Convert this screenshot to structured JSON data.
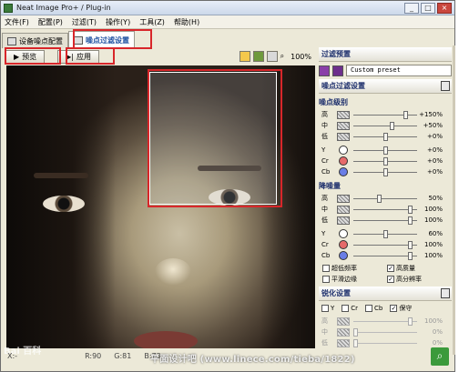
{
  "window": {
    "title": "Neat Image Pro+ / Plug-in",
    "buttons": [
      "_",
      "□",
      "×"
    ]
  },
  "menu": [
    "文件(F)",
    "配置(P)",
    "过滤(T)",
    "操作(Y)",
    "工具(Z)",
    "帮助(H)"
  ],
  "tabs": [
    {
      "label": "设备噪点配置",
      "active": false
    },
    {
      "label": "噪点过滤设置",
      "active": true
    }
  ],
  "toolbar": {
    "preview_label": "预览",
    "apply_label": "应用",
    "zoom": "100%"
  },
  "status": {
    "xy": "X:-",
    "r": "R:90",
    "g": "G:81",
    "b": "B:73"
  },
  "watermark": {
    "left": "Bai 百科",
    "bottom": "平面设计吧 (www.linece.com/tieba/1822)"
  },
  "filter_preset": {
    "title": "过滤预置",
    "value": "Custom preset"
  },
  "noise_filter": {
    "title": "噪点过滤设置",
    "level_title": "噪点级别",
    "levels": [
      {
        "label": "高",
        "value": "+150%",
        "pos": 0.85
      },
      {
        "label": "中",
        "value": "+50%",
        "pos": 0.62
      },
      {
        "label": "低",
        "value": "+0%",
        "pos": 0.5
      }
    ],
    "channels": [
      {
        "label": "Y",
        "value": "+0%",
        "color": "#ffffff",
        "pos": 0.5
      },
      {
        "label": "Cr",
        "value": "+0%",
        "color": "#e66a6a",
        "pos": 0.5
      },
      {
        "label": "Cb",
        "value": "+0%",
        "color": "#6a7ee6",
        "pos": 0.5
      }
    ],
    "reduction_title": "降噪量",
    "reductions": [
      {
        "label": "高",
        "value": "50%",
        "pos": 0.4
      },
      {
        "label": "中",
        "value": "100%",
        "pos": 0.92
      },
      {
        "label": "低",
        "value": "100%",
        "pos": 0.92
      }
    ],
    "reduction_channels": [
      {
        "label": "Y",
        "value": "60%",
        "color": "#ffffff",
        "pos": 0.5
      },
      {
        "label": "Cr",
        "value": "100%",
        "color": "#e66a6a",
        "pos": 0.92
      },
      {
        "label": "Cb",
        "value": "100%",
        "color": "#6a7ee6",
        "pos": 0.92
      }
    ],
    "options": [
      {
        "label": "超低频率",
        "checked": false
      },
      {
        "label": "高质量",
        "checked": true
      },
      {
        "label": "平滑边缘",
        "checked": false
      },
      {
        "label": "高分辨率",
        "checked": true
      }
    ]
  },
  "sharpen": {
    "title": "锐化设置",
    "checks": [
      {
        "label": "Y",
        "checked": false
      },
      {
        "label": "Cr",
        "checked": false
      },
      {
        "label": "Cb",
        "checked": false
      },
      {
        "label": "保守",
        "checked": true
      }
    ],
    "rows": [
      {
        "label": "高",
        "value": "100%"
      },
      {
        "label": "中",
        "value": "0%"
      },
      {
        "label": "低",
        "value": "0%"
      }
    ]
  }
}
